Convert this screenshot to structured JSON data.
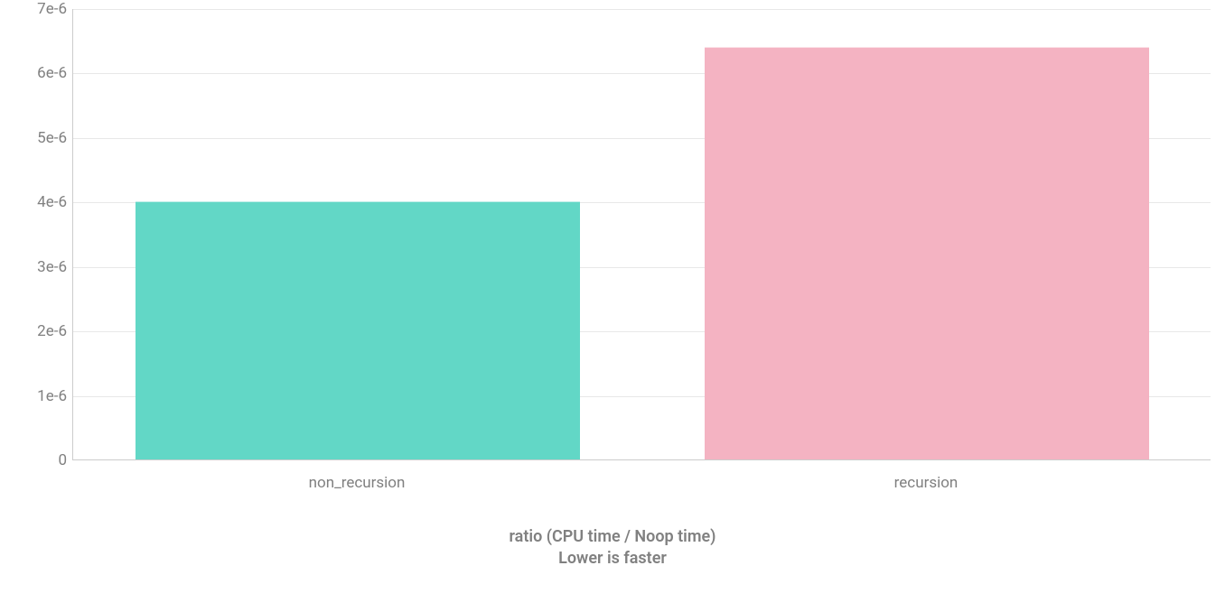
{
  "chart_data": {
    "type": "bar",
    "categories": [
      "non_recursion",
      "recursion"
    ],
    "values": [
      4e-06,
      6.4e-06
    ],
    "colors": [
      "#62d7c6",
      "#f4b3c2"
    ],
    "xlabel_line1": "ratio (CPU time / Noop time)",
    "xlabel_line2": "Lower is faster",
    "ylim": [
      0,
      7e-06
    ],
    "y_ticks": [
      {
        "v": 0,
        "label": "0"
      },
      {
        "v": 1e-06,
        "label": "1e-6"
      },
      {
        "v": 2e-06,
        "label": "2e-6"
      },
      {
        "v": 3e-06,
        "label": "3e-6"
      },
      {
        "v": 4e-06,
        "label": "4e-6"
      },
      {
        "v": 5e-06,
        "label": "5e-6"
      },
      {
        "v": 6e-06,
        "label": "6e-6"
      },
      {
        "v": 7e-06,
        "label": "7e-6"
      }
    ]
  }
}
